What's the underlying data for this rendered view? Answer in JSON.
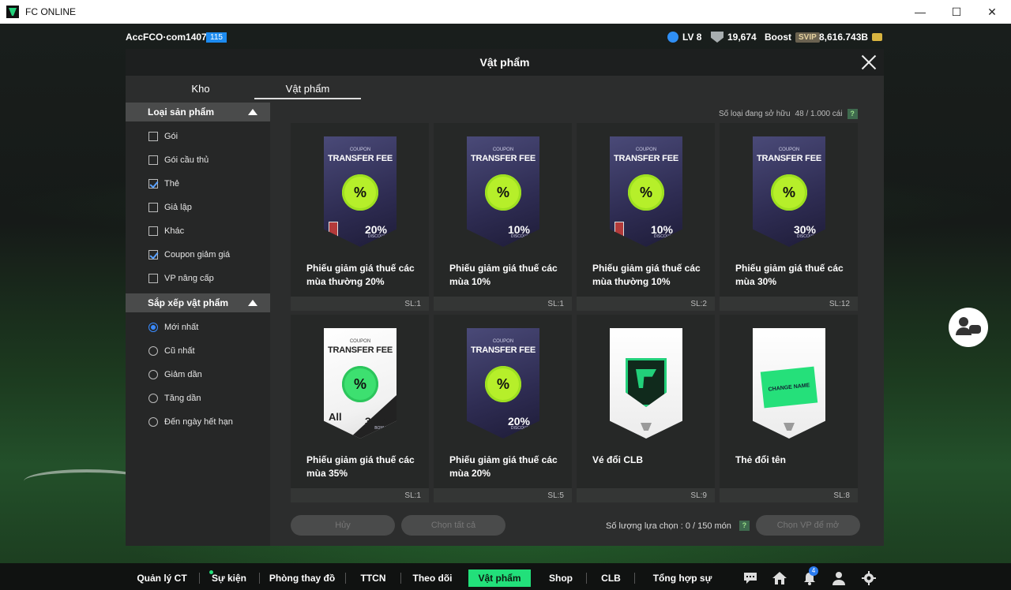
{
  "window": {
    "title": "FC ONLINE",
    "minimize": "—",
    "maximize": "☐",
    "close": "✕"
  },
  "top": {
    "account": "AccFCO·com1407a",
    "account_level": "115",
    "lv": "LV 8",
    "rank_points": "19,674",
    "boost_label": "Boost",
    "svip_label": "SVIP",
    "bp": "8,616.743B"
  },
  "modal": {
    "title": "Vật phẩm",
    "tabs": [
      "Kho",
      "Vật phẩm"
    ],
    "owned_label": "Số loại đang sở hữu",
    "owned_value": "48 / 1.000 cái",
    "help": "?"
  },
  "filters": {
    "type_title": "Loại sản phẩm",
    "types": [
      {
        "label": "Gói",
        "checked": false
      },
      {
        "label": "Gói cầu thủ",
        "checked": false
      },
      {
        "label": "Thẻ",
        "checked": true
      },
      {
        "label": "Giả lập",
        "checked": false
      },
      {
        "label": "Khác",
        "checked": false
      },
      {
        "label": "Coupon giảm giá",
        "checked": true
      },
      {
        "label": "VP nâng cấp",
        "checked": false
      }
    ],
    "sort_title": "Sắp xếp vật phẩm",
    "sorts": [
      {
        "label": "Mới nhất",
        "selected": true
      },
      {
        "label": "Cũ nhất",
        "selected": false
      },
      {
        "label": "Giảm dần",
        "selected": false
      },
      {
        "label": "Tăng dần",
        "selected": false
      },
      {
        "label": "Đến ngày hết hạn",
        "selected": false
      }
    ]
  },
  "coupon_text": {
    "small": "COUPON",
    "title": "TRANSFER FEE",
    "percent_glyph": "%",
    "discount": "DISCOUNT",
    "bonus": "BONUS",
    "all": "All",
    "change_name": "CHANGE NAME"
  },
  "items": [
    {
      "name": "Phiếu giảm giá thuế các mùa thường 20%",
      "qty": "SL:1",
      "pct": "20",
      "style": "dark",
      "blocked": true
    },
    {
      "name": "Phiếu giảm giá thuế các mùa 10%",
      "qty": "SL:1",
      "pct": "10",
      "style": "dark",
      "blocked": false
    },
    {
      "name": "Phiếu giảm giá thuế các mùa thường 10%",
      "qty": "SL:2",
      "pct": "10",
      "style": "dark",
      "blocked": true
    },
    {
      "name": "Phiếu giảm giá thuế các mùa 30%",
      "qty": "SL:12",
      "pct": "30",
      "style": "dark",
      "blocked": false
    },
    {
      "name": "Phiếu giảm giá thuế các mùa 35%",
      "qty": "SL:1",
      "pct": "35",
      "style": "white",
      "blocked": false
    },
    {
      "name": "Phiếu giảm giá thuế các mùa 20%",
      "qty": "SL:5",
      "pct": "20",
      "style": "dark",
      "blocked": false
    },
    {
      "name": "Vé đổi CLB",
      "qty": "SL:9",
      "style": "club"
    },
    {
      "name": "Thẻ đổi tên",
      "qty": "SL:8",
      "style": "rename"
    }
  ],
  "actions": {
    "cancel": "Hủy",
    "select_all": "Chọn tất cả",
    "selected_label": "Số lượng lựa chọn : 0 / 150 món",
    "select_vp": "Chọn VP để mở"
  },
  "nav": {
    "items": [
      "Quản lý CT",
      "Sự kiện",
      "Phòng thay đồ",
      "TTCN",
      "Theo dõi",
      "Vật phẩm",
      "Shop",
      "CLB",
      "Tổng hợp sự kiện"
    ],
    "active": "Vật phẩm",
    "notif_count": "4"
  },
  "colors": {
    "accent": "#22e07a",
    "checkbox": "#5aa2ff",
    "coupon_badge": "#b6ef2a"
  }
}
